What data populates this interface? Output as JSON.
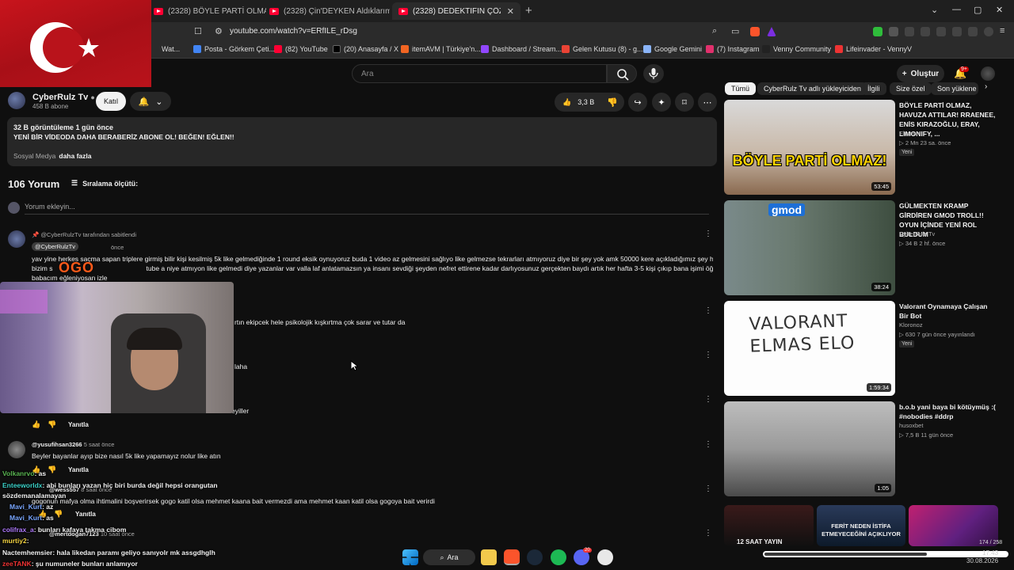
{
  "browser": {
    "tabs": [
      {
        "label": "(2328) BÖYLE PARTİ OLMAZ, HAVUZA ATTILAR! Toplu",
        "active": false
      },
      {
        "label": "(2328) Çin'DEYKEN Aldıklarım! Toplu",
        "active": false
      },
      {
        "label": "(2328) DEDEKTİFİN ÇÖZEMEYECEĞİ",
        "active": true
      }
    ],
    "url": "youtube.com/watch?v=ERfILE_rDsg",
    "bookmarks": [
      "Wat...",
      "Posta - Görkem Çeti...",
      "(82) YouTube",
      "(20) Anasayfa / X",
      "itemAVM | Türkiye'n...",
      "Dashboard / Stream...",
      "Gelen Kutusu (8) - g...",
      "Google Gemini",
      "(7) Instagram",
      "Venny Community",
      "Lifeinvader - VennyV"
    ]
  },
  "youtube": {
    "search_placeholder": "Ara",
    "create_label": "Oluştur",
    "notif_badge": "9+",
    "chips": [
      "Tümü",
      "CyberRulz Tv adlı yükleyiciden",
      "İlgili",
      "Size özel",
      "Son yüklene"
    ],
    "channel": {
      "name": "CyberRulz Tv",
      "subs": "458 B abone",
      "join_label": "Katıl"
    },
    "likes": "3,3 B",
    "description": {
      "views_line": "32 B görüntüleme  1 gün önce",
      "body": "YENİ BİR VİDEODA DAHA BERABERİZ  ABONE OL!  BEĞEN!  EĞLEN!!",
      "social": "Sosyal Medya",
      "more": "daha fazla"
    },
    "comments_count": "106 Yorum",
    "sort_label": "Sıralama ölçütü:",
    "add_comment": "Yorum ekleyin...",
    "pinned_by": "@CyberRulzTv tarafından sabitlendi",
    "comments": [
      {
        "author": "@CyberRulzTv",
        "time": "önce",
        "text1": "yav yine herkes saçma sapan triplere girmiş bilir kişi kesilmiş 5k like gelmediğinde 1 round eksik oynuyoruz buda 1 video az gelmesini sağlıyo like gelmezse tekrarları atmıyoruz diye bir şey yok amk  50000 kere açıkladığımız şey hala",
        "text2": "bizim s                                                  tube a niye atmıyon like gelmedi diye yazanlar var valla laf anlatamazsın ya insanı sevdiği şeyden nefret ettirene kadar darlıyosunuz gerçekten baydı artık her hafta 3-5 kişi çıkıp bana işimi öğretmeye çalışıyo",
        "text3": "babacım eğleniyosan izle"
      },
      {
        "text1": "rtın ekipcek hele psikolojik kışkırtma çok sarar ve tutar da"
      },
      {
        "text1": "laha"
      },
      {
        "text1": "eyiller"
      },
      {
        "author": "@yusufihsan3266",
        "time": "5 saat önce",
        "text1": "Beyler bayanlar ayıp bize nasıl 5k like yapamayız nolur like atın"
      },
      {
        "author": "@wess557",
        "time": "8 saat önce",
        "text1": "gogonun mafya olma ihtimalini boşverirsek gogo katil olsa mehmet kaana bait vermezdi ama mehmet kaan katil olsa gogoya bait verirdi"
      },
      {
        "author": "@mertdogan7123",
        "time": "10 saat önce"
      }
    ],
    "reply_label": "Yanıtla"
  },
  "sidebar": [
    {
      "title": "BÖYLE PARTİ OLMAZ, HAVUZA ATTILAR! RRAENEE, ENİS KIRAZOĞLU, ERAY, LIMONIFY, ...",
      "channel": "Elraenn",
      "meta": "▷ 2 Mn  23 sa. önce",
      "new": "Yeni",
      "duration": "53:45",
      "overlay": "BÖYLE PARTİ OLMAZ!"
    },
    {
      "title": "GÜLMEKTEN KRAMP GİRDİREN GMOD TROLL!! OYUN İÇİNDE YENİ ROL BULDUM",
      "channel": "CyberRulz Tv",
      "meta": "▷ 34 B  2 hf. önce",
      "duration": "38:24",
      "overlay": "gmod"
    },
    {
      "title": "Valorant Oynamaya Çalışan Bir Bot",
      "channel": "Kloronoz",
      "meta": "▷ 630  7 gün önce yayınlandı",
      "new": "Yeni",
      "duration": "1:59:34",
      "overlay": "VALORANT ELMAS ELO"
    },
    {
      "title": "b.o.b yani baya bi kötüymüş :( #nobodies #ddrp",
      "channel": "husoxbet",
      "meta": "▷ 7,5 B  11 gün önce",
      "duration": "1:05"
    }
  ],
  "shorts": [
    "12 SAAT YAYIN",
    "FERİT NEDEN İSTİFA ETMEYECEĞİNİ AÇIKLIYOR"
  ],
  "overlay_logo": "OGO",
  "chat": [
    {
      "user": "Volkanrvo",
      "msg": ": as",
      "color": "#5ab552"
    },
    {
      "user": "Enteeworldx",
      "msg": ": abi bunları yazan hiç biri burda değil hepsi orangutan",
      "color": "#3bd0c7"
    },
    {
      "user": "sözde",
      "msg": "manalamayan",
      "color": "#f1f1f1"
    },
    {
      "user": "Mavi_Kurt",
      "msg": ": az",
      "color": "#7aa7ff"
    },
    {
      "user": "Mavi_Kurt",
      "msg": ": as",
      "color": "#7aa7ff"
    },
    {
      "user": "colifrax_a",
      "msg": ": bunları kafaya takma cibom",
      "color": "#b07aff"
    },
    {
      "user": "murtiy2",
      "msg": ":",
      "color": "#f5d442"
    },
    {
      "user": "Nactemhemsier",
      "msg": ": hala likedan paramı geliyo sanıyolr mk assgdhglh",
      "color": "#f1f1f1"
    },
    {
      "user": "zeeTANK",
      "msg": ": şu numuneler bunları anlamıyor",
      "color": "#e33"
    }
  ],
  "taskbar": {
    "search_label": "Ara",
    "discord_badge": "20",
    "time": "17:43",
    "date": "30.08.2026"
  },
  "player": {
    "time": "174 / 258",
    "progress": 0.67
  }
}
